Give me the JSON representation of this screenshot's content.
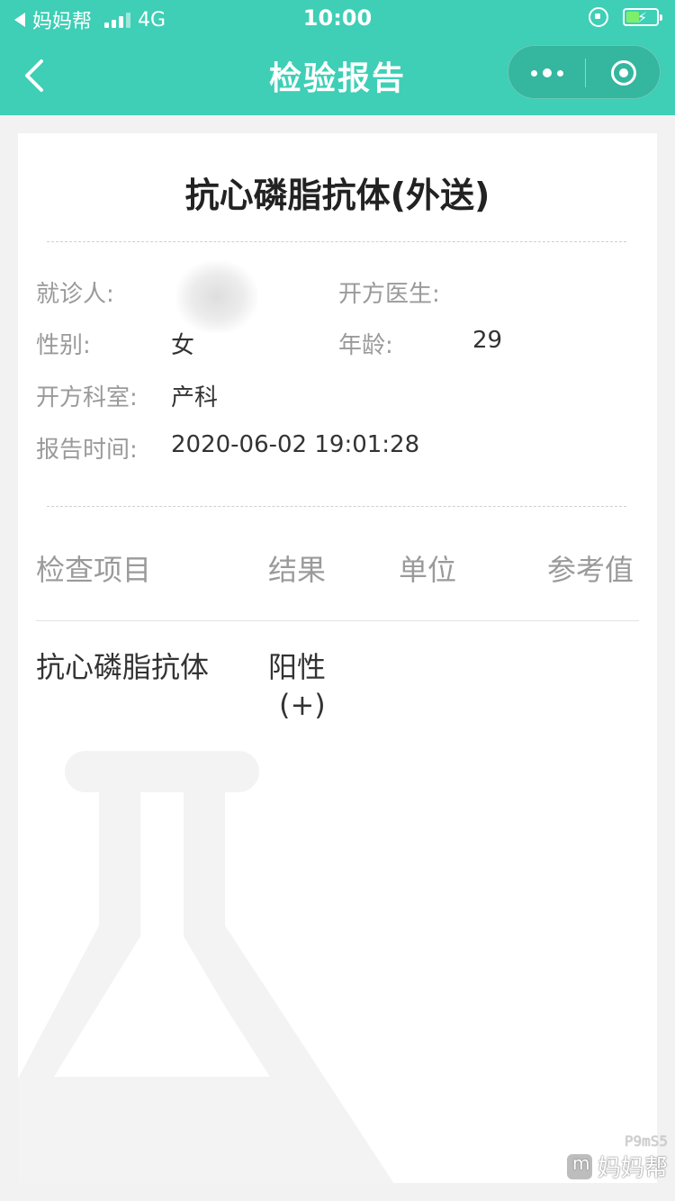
{
  "status_bar": {
    "carrier": "妈妈帮",
    "network": "4G",
    "time": "10:00"
  },
  "nav": {
    "title": "检验报告"
  },
  "report": {
    "title": "抗心磷脂抗体(外送)",
    "patient_label": "就诊人:",
    "doctor_label": "开方医生:",
    "gender_label": "性别:",
    "gender_value": "女",
    "age_label": "年龄:",
    "age_value": "29",
    "department_label": "开方科室:",
    "department_value": "产科",
    "report_time_label": "报告时间:",
    "report_time_value": "2020-06-02 19:01:28"
  },
  "table": {
    "headers": [
      "检查项目",
      "结果",
      "单位",
      "参考值"
    ],
    "rows": [
      {
        "item": "抗心磷脂抗体",
        "result_line1": "阳性",
        "result_line2": "(+)",
        "unit": "",
        "reference": ""
      }
    ]
  },
  "watermark": {
    "id": "P9mS5",
    "brand": "妈妈帮"
  },
  "colors": {
    "header_bg": "#3ecfb6",
    "capsule_bg": "#35b69f",
    "label_text": "#9a9a9a",
    "value_text": "#333333"
  }
}
